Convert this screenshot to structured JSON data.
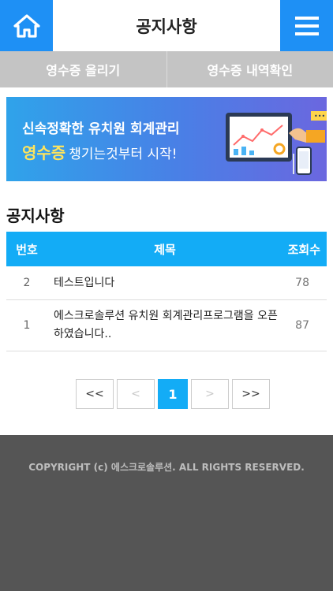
{
  "header": {
    "title": "공지사항",
    "home_icon": "home-icon",
    "menu_icon": "hamburger-menu-icon"
  },
  "subnav": {
    "upload_label": "영수증 올리기",
    "history_label": "영수증 내역확인"
  },
  "banner": {
    "line1": "신속정확한 유치원 회계관리",
    "accent": "영수증",
    "line2_rest": "챙기는것부터 시작!"
  },
  "notice": {
    "section_title": "공지사항",
    "columns": {
      "no": "번호",
      "title": "제목",
      "views": "조회수"
    },
    "rows": [
      {
        "no": "2",
        "title": "테스트입니다",
        "views": "78"
      },
      {
        "no": "1",
        "title": "에스크로솔루션 유치원 회계관리프로그램을 오픈 하였습니다..",
        "views": "87"
      }
    ]
  },
  "pagination": {
    "first": "<<",
    "prev": "<",
    "current": "1",
    "next": ">",
    "last": ">>"
  },
  "footer": {
    "copyright": "COPYRIGHT (c) 에스크로솔루션. ALL RIGHTS RESERVED."
  },
  "colors": {
    "primary": "#1e90f5",
    "table_header": "#13acf6",
    "subnav_bg": "#c4c4c4",
    "footer_bg": "#555555",
    "banner_accent": "#ffe45c"
  }
}
